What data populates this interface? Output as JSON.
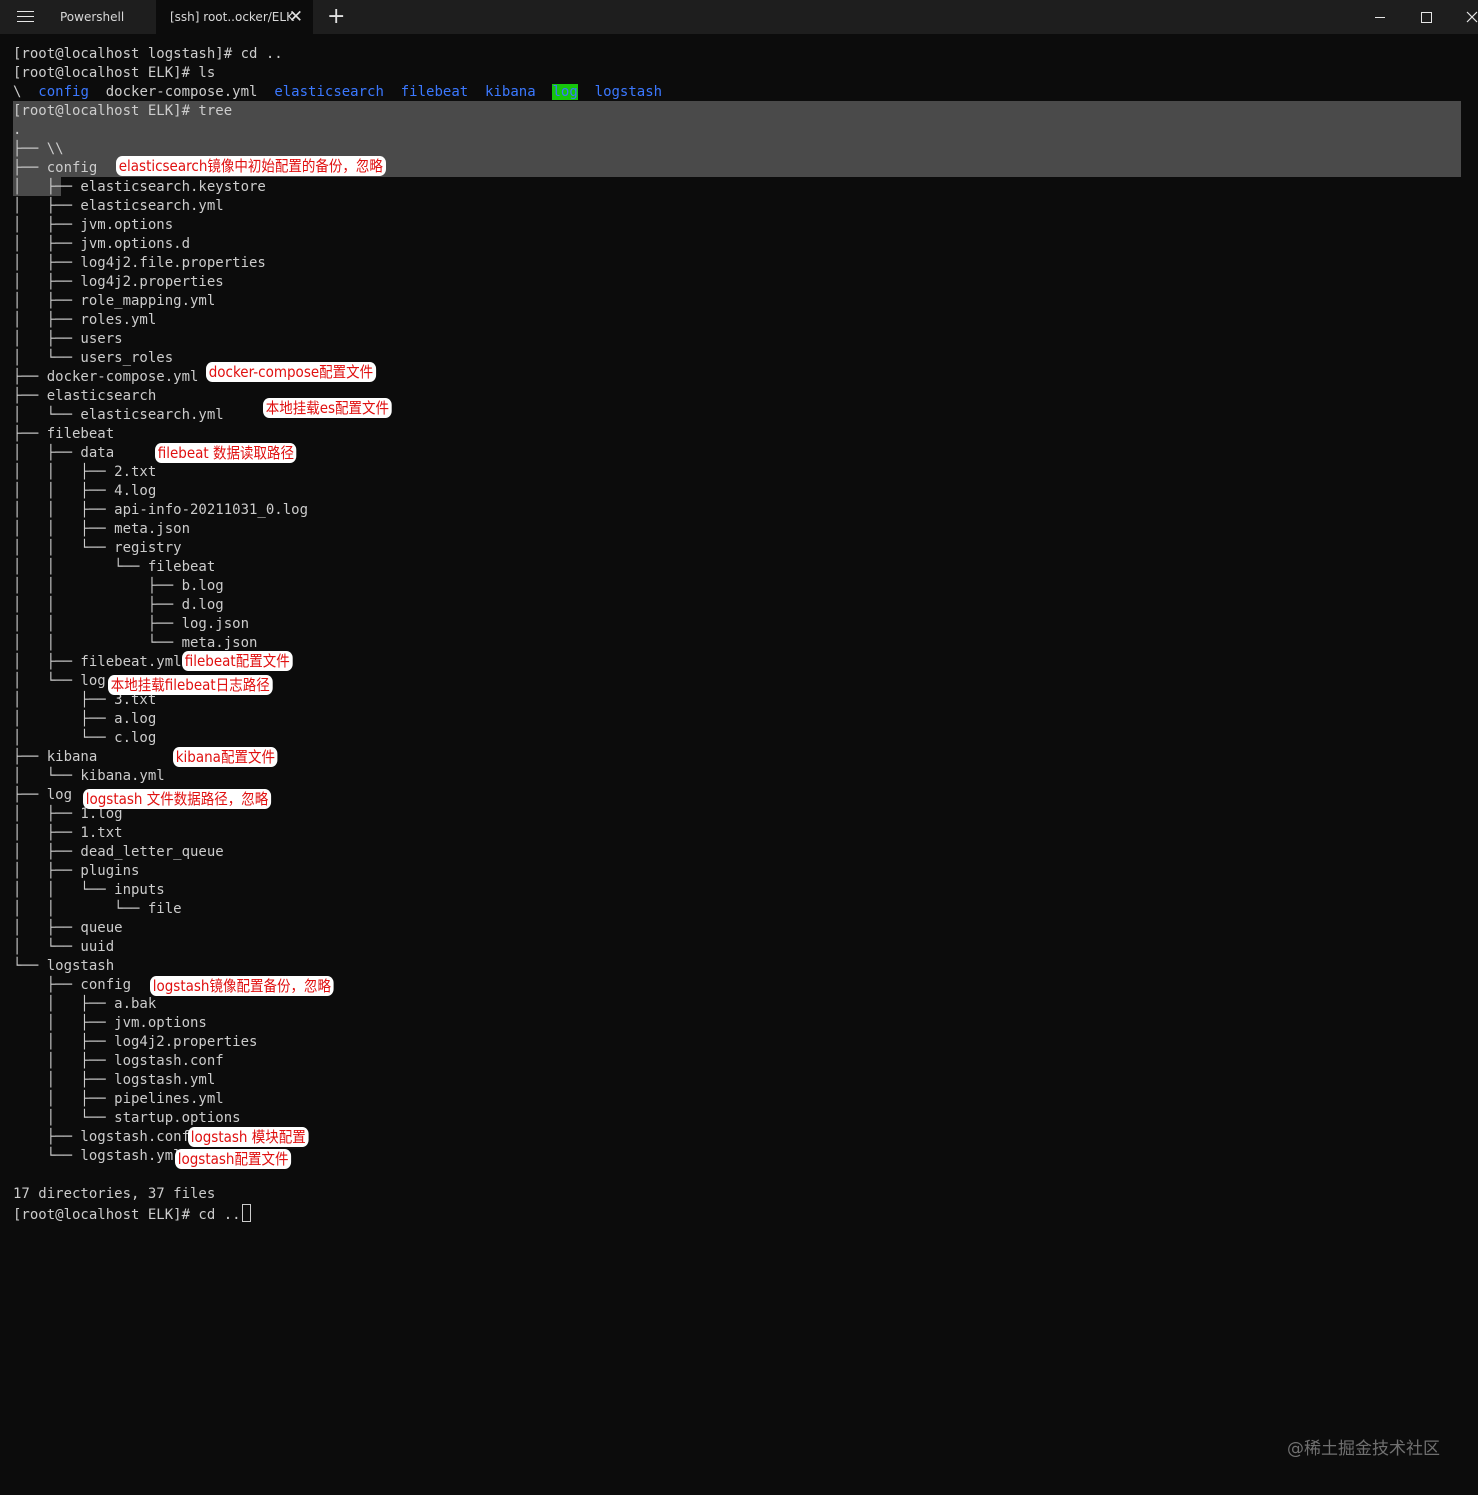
{
  "tabs": [
    {
      "label": "Powershell"
    },
    {
      "label": "[ssh] root..ocker/ELK"
    }
  ],
  "icons": {
    "menu": "hamburger-menu-icon",
    "close_tab": "close-icon",
    "new_tab": "plus-icon",
    "minimize": "minimize-icon",
    "maximize": "maximize-icon",
    "close_window": "close-icon"
  },
  "new_tab_label": "+",
  "tab_close_label": "✕",
  "colors": {
    "background": "#0c0c0c",
    "text": "#cccccc",
    "directory": "#3b78ff",
    "highlight_bg": "#16c60c",
    "annotation": "#e01010",
    "selection": "#4a4a4a"
  },
  "terminal": {
    "lines": [
      {
        "text": "[root@localhost logstash]# cd .."
      },
      {
        "text": "[root@localhost ELK]# ls"
      },
      {
        "parts": [
          {
            "t": "\\  ",
            "c": "plain"
          },
          {
            "t": "config",
            "c": "dir"
          },
          {
            "t": "  docker-compose.yml  ",
            "c": "plain"
          },
          {
            "t": "elasticsearch",
            "c": "dir"
          },
          {
            "t": "  ",
            "c": "plain"
          },
          {
            "t": "filebeat",
            "c": "dir"
          },
          {
            "t": "  ",
            "c": "plain"
          },
          {
            "t": "kibana",
            "c": "dir"
          },
          {
            "t": "  ",
            "c": "plain"
          },
          {
            "t": "log",
            "c": "hl"
          },
          {
            "t": "  ",
            "c": "plain"
          },
          {
            "t": "logstash",
            "c": "dir"
          }
        ]
      },
      {
        "text": "[root@localhost ELK]# tree"
      },
      {
        "text": "."
      },
      {
        "text": "├── \\\\"
      },
      {
        "text": "├── config"
      },
      {
        "text": "│   ├── elasticsearch.keystore"
      },
      {
        "text": "│   ├── elasticsearch.yml"
      },
      {
        "text": "│   ├── jvm.options"
      },
      {
        "text": "│   ├── jvm.options.d"
      },
      {
        "text": "│   ├── log4j2.file.properties"
      },
      {
        "text": "│   ├── log4j2.properties"
      },
      {
        "text": "│   ├── role_mapping.yml"
      },
      {
        "text": "│   ├── roles.yml"
      },
      {
        "text": "│   ├── users"
      },
      {
        "text": "│   └── users_roles"
      },
      {
        "text": "├── docker-compose.yml"
      },
      {
        "text": "├── elasticsearch"
      },
      {
        "text": "│   └── elasticsearch.yml"
      },
      {
        "text": "├── filebeat"
      },
      {
        "text": "│   ├── data"
      },
      {
        "text": "│   │   ├── 2.txt"
      },
      {
        "text": "│   │   ├── 4.log"
      },
      {
        "text": "│   │   ├── api-info-20211031_0.log"
      },
      {
        "text": "│   │   ├── meta.json"
      },
      {
        "text": "│   │   └── registry"
      },
      {
        "text": "│   │       └── filebeat"
      },
      {
        "text": "│   │           ├── b.log"
      },
      {
        "text": "│   │           ├── d.log"
      },
      {
        "text": "│   │           ├── log.json"
      },
      {
        "text": "│   │           └── meta.json"
      },
      {
        "text": "│   ├── filebeat.yml"
      },
      {
        "text": "│   └── log"
      },
      {
        "text": "│       ├── 3.txt"
      },
      {
        "text": "│       ├── a.log"
      },
      {
        "text": "│       └── c.log"
      },
      {
        "text": "├── kibana"
      },
      {
        "text": "│   └── kibana.yml"
      },
      {
        "text": "├── log"
      },
      {
        "text": "│   ├── 1.log"
      },
      {
        "text": "│   ├── 1.txt"
      },
      {
        "text": "│   ├── dead_letter_queue"
      },
      {
        "text": "│   ├── plugins"
      },
      {
        "text": "│   │   └── inputs"
      },
      {
        "text": "│   │       └── file"
      },
      {
        "text": "│   ├── queue"
      },
      {
        "text": "│   └── uuid"
      },
      {
        "text": "└── logstash"
      },
      {
        "text": "    ├── config"
      },
      {
        "text": "    │   ├── a.bak"
      },
      {
        "text": "    │   ├── jvm.options"
      },
      {
        "text": "    │   ├── log4j2.properties"
      },
      {
        "text": "    │   ├── logstash.conf"
      },
      {
        "text": "    │   ├── logstash.yml"
      },
      {
        "text": "    │   ├── pipelines.yml"
      },
      {
        "text": "    │   └── startup.options"
      },
      {
        "text": "    ├── logstash.conf"
      },
      {
        "text": "    └── logstash.yml"
      },
      {
        "text": ""
      },
      {
        "text": "17 directories, 37 files"
      },
      {
        "text": "[root@localhost ELK]# cd ..",
        "cursor": true
      }
    ]
  },
  "annotations": [
    {
      "text": "elasticsearch镜像中初始配置的备份，忽略"
    },
    {
      "text": "docker-compose配置文件"
    },
    {
      "text": "本地挂载es配置文件"
    },
    {
      "text": "filebeat 数据读取路径"
    },
    {
      "text": "filebeat配置文件"
    },
    {
      "text": "本地挂载filebeat日志路径"
    },
    {
      "text": "kibana配置文件"
    },
    {
      "text": "logstash 文件数据路径，忽略"
    },
    {
      "text": "logstash镜像配置备份，忽略"
    },
    {
      "text": "logstash 模块配置"
    },
    {
      "text": "logstash配置文件"
    }
  ],
  "watermark": "@稀土掘金技术社区"
}
